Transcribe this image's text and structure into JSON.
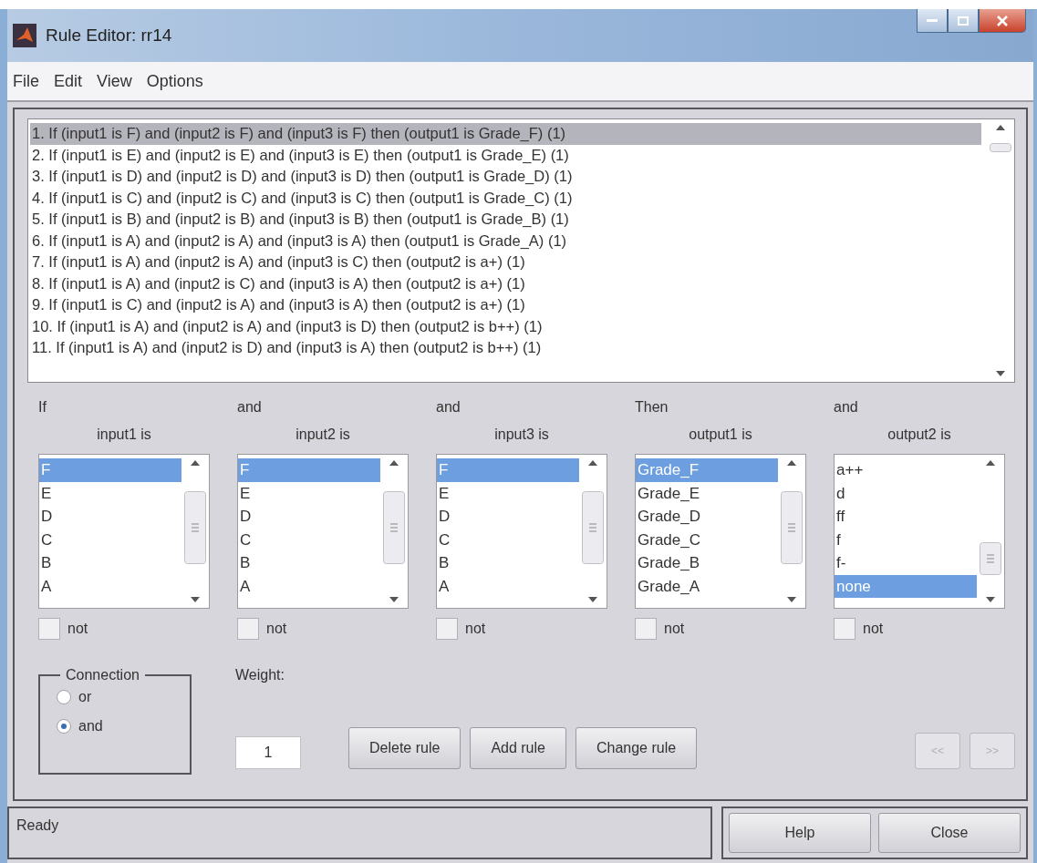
{
  "window": {
    "title": "Rule Editor: rr14"
  },
  "menu": [
    "File",
    "Edit",
    "View",
    "Options"
  ],
  "rules": [
    {
      "text": "1. If (input1 is F) and (input2 is F) and (input3 is F) then (output1 is Grade_F) (1)",
      "selected": true
    },
    {
      "text": "2. If (input1 is E) and (input2 is E) and (input3 is E) then (output1 is Grade_E) (1)",
      "selected": false
    },
    {
      "text": "3. If (input1 is D) and (input2 is D) and (input3 is D) then (output1 is Grade_D) (1)",
      "selected": false
    },
    {
      "text": "4. If (input1 is C) and (input2 is C) and (input3 is C) then (output1 is Grade_C) (1)",
      "selected": false
    },
    {
      "text": "5. If (input1 is B) and (input2 is B) and (input3 is B) then (output1 is Grade_B) (1)",
      "selected": false
    },
    {
      "text": "6. If (input1 is A) and (input2 is A) and (input3 is A) then (output1 is Grade_A) (1)",
      "selected": false
    },
    {
      "text": "7. If (input1 is A) and (input2 is A) and (input3 is C) then (output2 is a+) (1)",
      "selected": false
    },
    {
      "text": "8. If (input1 is A) and (input2 is C) and (input3 is A) then (output2 is a+) (1)",
      "selected": false
    },
    {
      "text": "9. If (input1 is C) and (input2 is A) and (input3 is A) then (output2 is a+) (1)",
      "selected": false
    },
    {
      "text": "10. If (input1 is A) and (input2 is A) and (input3 is D) then (output2 is b++) (1)",
      "selected": false
    },
    {
      "text": "11. If (input1 is A) and (input2 is D) and (input3 is A) then (output2 is b++) (1)",
      "selected": false
    }
  ],
  "columns": [
    {
      "connective": "If",
      "label": "input1 is",
      "items": [
        {
          "text": "F",
          "selected": true
        },
        {
          "text": "E",
          "selected": false
        },
        {
          "text": "D",
          "selected": false
        },
        {
          "text": "C",
          "selected": false
        },
        {
          "text": "B",
          "selected": false
        },
        {
          "text": "A",
          "selected": false
        }
      ],
      "not": {
        "label": "not",
        "checked": false
      }
    },
    {
      "connective": "and",
      "label": "input2 is",
      "items": [
        {
          "text": "F",
          "selected": true
        },
        {
          "text": "E",
          "selected": false
        },
        {
          "text": "D",
          "selected": false
        },
        {
          "text": "C",
          "selected": false
        },
        {
          "text": "B",
          "selected": false
        },
        {
          "text": "A",
          "selected": false
        }
      ],
      "not": {
        "label": "not",
        "checked": false
      }
    },
    {
      "connective": "and",
      "label": "input3 is",
      "items": [
        {
          "text": "F",
          "selected": true
        },
        {
          "text": "E",
          "selected": false
        },
        {
          "text": "D",
          "selected": false
        },
        {
          "text": "C",
          "selected": false
        },
        {
          "text": "B",
          "selected": false
        },
        {
          "text": "A",
          "selected": false
        }
      ],
      "not": {
        "label": "not",
        "checked": false
      }
    },
    {
      "connective": "Then",
      "label": "output1 is",
      "items": [
        {
          "text": "Grade_F",
          "selected": true
        },
        {
          "text": "Grade_E",
          "selected": false
        },
        {
          "text": "Grade_D",
          "selected": false
        },
        {
          "text": "Grade_C",
          "selected": false
        },
        {
          "text": "Grade_B",
          "selected": false
        },
        {
          "text": "Grade_A",
          "selected": false
        }
      ],
      "not": {
        "label": "not",
        "checked": false
      }
    },
    {
      "connective": "and",
      "label": "output2 is",
      "items": [
        {
          "text": "a++",
          "selected": false
        },
        {
          "text": "d",
          "selected": false
        },
        {
          "text": "ff",
          "selected": false
        },
        {
          "text": "f",
          "selected": false
        },
        {
          "text": "f-",
          "selected": false
        },
        {
          "text": "none",
          "selected": true
        }
      ],
      "not": {
        "label": "not",
        "checked": false
      }
    }
  ],
  "connection": {
    "title": "Connection",
    "options": [
      {
        "label": "or",
        "selected": false
      },
      {
        "label": "and",
        "selected": true
      }
    ]
  },
  "weight": {
    "label": "Weight:",
    "value": "1"
  },
  "actions": [
    "Delete rule",
    "Add rule",
    "Change rule"
  ],
  "nav_buttons": [
    {
      "label": "<<",
      "disabled": true
    },
    {
      "label": ">>",
      "disabled": true
    }
  ],
  "status": "Ready",
  "footer_buttons": [
    "Help",
    "Close"
  ]
}
